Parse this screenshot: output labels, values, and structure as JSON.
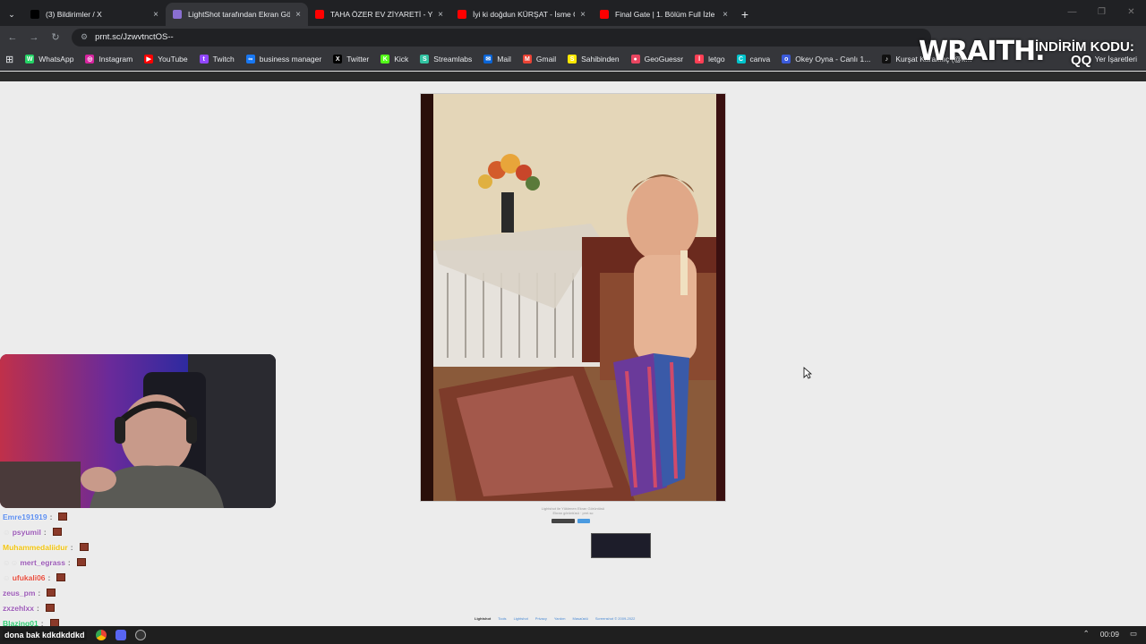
{
  "browser": {
    "tabs": [
      {
        "title": "(3) Bildirimler / X",
        "icon": "x-icon",
        "color": "#000000",
        "active": false
      },
      {
        "title": "LightShot tarafından Ekran Görü",
        "icon": "lightshot-icon",
        "color": "#8a6fd1",
        "active": true
      },
      {
        "title": "TAHA ÖZER EV ZİYARETİ - YouT",
        "icon": "youtube-icon",
        "color": "#ff0000",
        "active": false
      },
      {
        "title": "İyi ki doğdun KÜRŞAT - İsme Öz",
        "icon": "youtube-icon",
        "color": "#ff0000",
        "active": false
      },
      {
        "title": "Final Gate | 1. Bölüm Full İzle - ",
        "icon": "youtube-icon",
        "color": "#ff0000",
        "active": false
      }
    ],
    "tab_close": "×",
    "new_tab": "+",
    "url": "prnt.sc/JzwvtnctOS--",
    "bookmarks": [
      {
        "label": "WhatsApp",
        "color": "#25d366",
        "glyph": "W"
      },
      {
        "label": "Instagram",
        "color": "#d6249f",
        "glyph": "◎"
      },
      {
        "label": "YouTube",
        "color": "#ff0000",
        "glyph": "▶"
      },
      {
        "label": "Twitch",
        "color": "#9146ff",
        "glyph": "t"
      },
      {
        "label": "business manager",
        "color": "#1877f2",
        "glyph": "∞"
      },
      {
        "label": "Twitter",
        "color": "#000000",
        "glyph": "X"
      },
      {
        "label": "Kick",
        "color": "#53fc18",
        "glyph": "K"
      },
      {
        "label": "Streamlabs",
        "color": "#31c3a2",
        "glyph": "S"
      },
      {
        "label": "Mail",
        "color": "#0a64d6",
        "glyph": "✉"
      },
      {
        "label": "Gmail",
        "color": "#ea4335",
        "glyph": "M"
      },
      {
        "label": "Sahibinden",
        "color": "#ffe800",
        "glyph": "S"
      },
      {
        "label": "GeoGuessr",
        "color": "#e94560",
        "glyph": "●"
      },
      {
        "label": "letgo",
        "color": "#ff3f55",
        "glyph": "l"
      },
      {
        "label": "canva",
        "color": "#00c4cc",
        "glyph": "C"
      },
      {
        "label": "Okey Oyna - Canlı 1...",
        "color": "#3b5bdb",
        "glyph": "o"
      },
      {
        "label": "Kurşat Karakılıç (@k...",
        "color": "#111111",
        "glyph": "♪"
      }
    ],
    "bookmarks_right": "Yer İşaretleri"
  },
  "overlay": {
    "brand": "WRAITH.",
    "promo_label": "İNDİRİM KODU:",
    "promo_code": "QQ"
  },
  "lightshot": {
    "caption_line1": "Lightshot ile Yüklenen Ekran Görüntüsü",
    "caption_line2": "Ekran görüntüsü · prnt.sc",
    "footer_links": [
      "Lightshot",
      "Tools",
      "Lightshot",
      "Privacy",
      "Yardım",
      "Masaüstü",
      "Screenshot © 2009-2022"
    ]
  },
  "chat": [
    {
      "user": "Emre191919",
      "color": "#5b8def",
      "msg": "",
      "badge": ""
    },
    {
      "user": "psyumil",
      "color": "#9b59b6",
      "msg": "",
      "badge": "☺"
    },
    {
      "user": "Muhammedaliidur",
      "color": "#f1c40f",
      "msg": "",
      "badge": ""
    },
    {
      "user": "mert_egrass",
      "color": "#9b59b6",
      "msg": "",
      "badge": "☺☺"
    },
    {
      "user": "ufukali06",
      "color": "#e74c3c",
      "msg": "",
      "badge": "☺"
    },
    {
      "user": "zeus_pm",
      "color": "#9b59b6",
      "msg": "",
      "badge": ""
    },
    {
      "user": "zxzehlxx",
      "color": "#9b59b6",
      "msg": "",
      "badge": ""
    },
    {
      "user": "Blazing01",
      "color": "#2ecc71",
      "msg": "",
      "badge": ""
    }
  ],
  "taskbar": {
    "message": "dona bak kdkdkddkd",
    "time": "00:09"
  }
}
